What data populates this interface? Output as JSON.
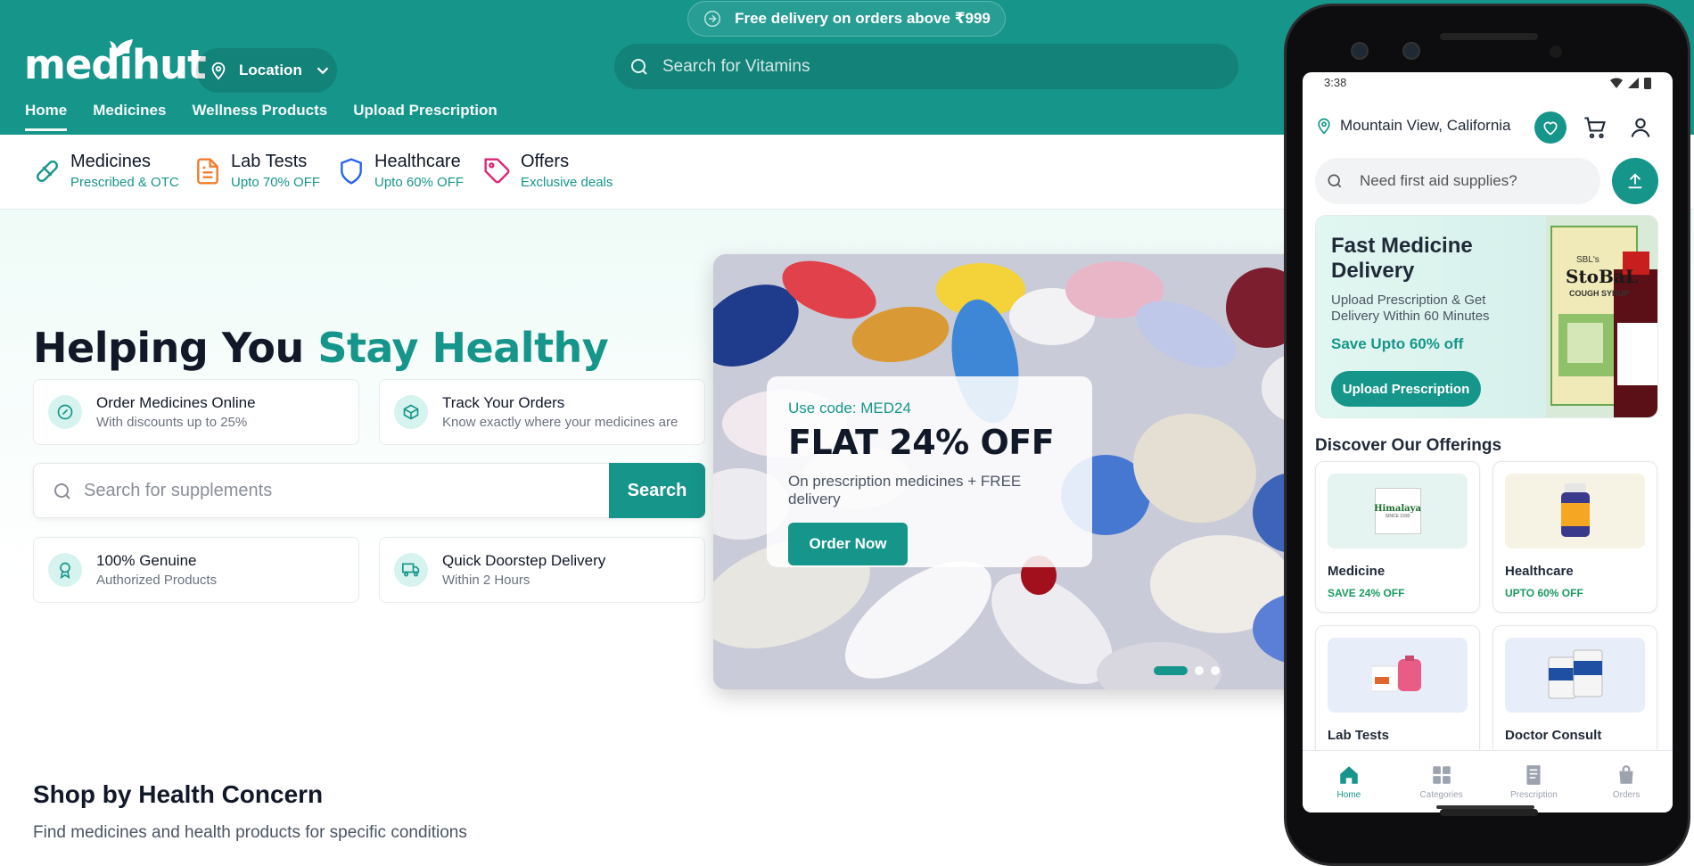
{
  "site": {
    "promo": "Free delivery on orders above ₹999",
    "logo": "medihut",
    "location_label": "Location",
    "search_placeholder": "Search for Vitamins",
    "nav": [
      {
        "label": "Home",
        "active": true
      },
      {
        "label": "Medicines"
      },
      {
        "label": "Wellness Products"
      },
      {
        "label": "Upload Prescription"
      }
    ],
    "categories": [
      {
        "title": "Medicines",
        "sub": "Prescribed & OTC",
        "icon": "pill-icon",
        "color": "#16958a"
      },
      {
        "title": "Lab Tests",
        "sub": "Upto 70% OFF",
        "icon": "document-icon",
        "color": "#f07c2a"
      },
      {
        "title": "Healthcare",
        "sub": "Upto 60% OFF",
        "icon": "shield-icon",
        "color": "#2563eb"
      },
      {
        "title": "Offers",
        "sub": "Exclusive deals",
        "icon": "tag-icon",
        "color": "#db2777"
      }
    ],
    "hero": {
      "title_a": "Helping You ",
      "title_b": "Stay Healthy",
      "features": [
        {
          "title": "Order Medicines Online",
          "sub": "With discounts up to 25%",
          "icon": "discount-icon"
        },
        {
          "title": "Track Your Orders",
          "sub": "Know exactly where your medicines are",
          "icon": "box-icon"
        },
        {
          "title": "100% Genuine",
          "sub": "Authorized Products",
          "icon": "award-icon"
        },
        {
          "title": "Quick Doorstep Delivery",
          "sub": "Within 2 Hours",
          "icon": "truck-icon"
        }
      ],
      "search_placeholder": "Search for supplements",
      "search_button": "Search"
    },
    "banner": {
      "code": "Use code: MED24",
      "title": "FLAT 24% OFF",
      "sub": "On prescription medicines + FREE delivery",
      "button": "Order Now",
      "slides": 3,
      "active_slide": 1
    },
    "section": {
      "title": "Shop by Health Concern",
      "sub": "Find medicines and health products for specific conditions"
    },
    "accent": "#16958a"
  },
  "phone": {
    "time": "3:38",
    "location": "Mountain View, California",
    "search_placeholder": "Need first aid supplies?",
    "promo": {
      "title": "Fast Medicine Delivery",
      "sub": "Upload Prescription & Get Delivery Within 60 Minutes",
      "save": "Save Upto 60% off",
      "button": "Upload Prescription",
      "product_brand": "SBL's",
      "product_name": "StoBaL",
      "product_sub": "COUGH SYRUP"
    },
    "offerings_title": "Discover Our Offerings",
    "offerings": [
      {
        "name": "Medicine",
        "save": "SAVE 24% OFF",
        "bg": "#e6f4f1"
      },
      {
        "name": "Healthcare",
        "save": "UPTO 60% OFF",
        "bg": "#f6f3e4"
      },
      {
        "name": "Lab Tests",
        "save": "",
        "bg": "#e8eef9"
      },
      {
        "name": "Doctor Consult",
        "save": "",
        "bg": "#e8eef9"
      }
    ],
    "himalaya_logo": "Himalaya",
    "himalaya_since": "SINCE 1930",
    "bottom_nav": [
      {
        "label": "Home",
        "icon": "home-icon",
        "active": true
      },
      {
        "label": "Categories",
        "icon": "grid-icon"
      },
      {
        "label": "Prescription",
        "icon": "prescription-icon"
      },
      {
        "label": "Orders",
        "icon": "bag-icon"
      }
    ]
  }
}
